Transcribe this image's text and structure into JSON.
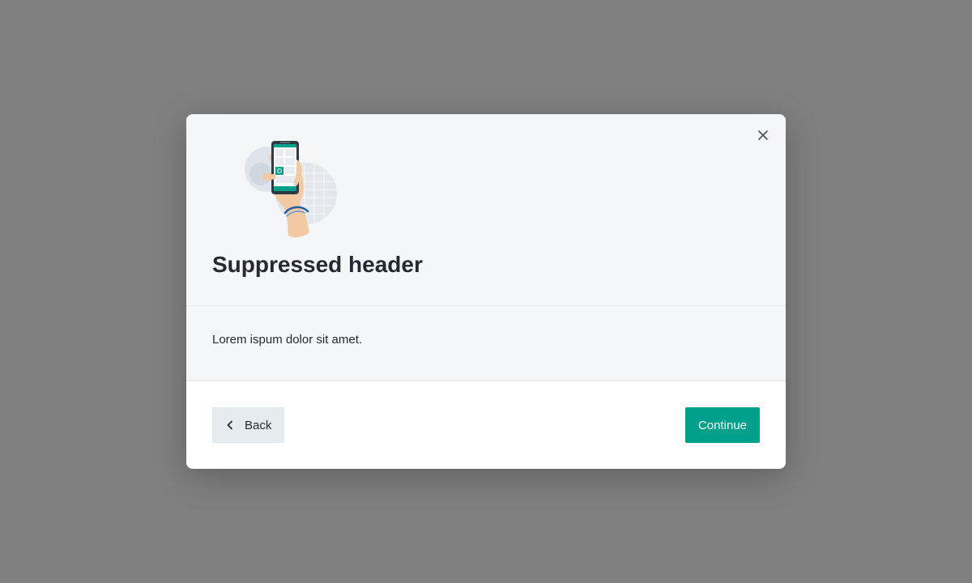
{
  "dialog": {
    "title": "Suppressed header",
    "body_text": "Lorem ispum dolor sit amet.",
    "illustration_icon": "phone-in-hand-illustration",
    "close_icon": "close-icon"
  },
  "footer": {
    "back_label": "Back",
    "back_icon": "chevron-left-icon",
    "continue_label": "Continue"
  },
  "colors": {
    "backdrop": "#808080",
    "header_bg": "#f5f6f8",
    "primary": "#00a08a",
    "secondary_button": "#e6ebef",
    "text": "#232a31"
  }
}
